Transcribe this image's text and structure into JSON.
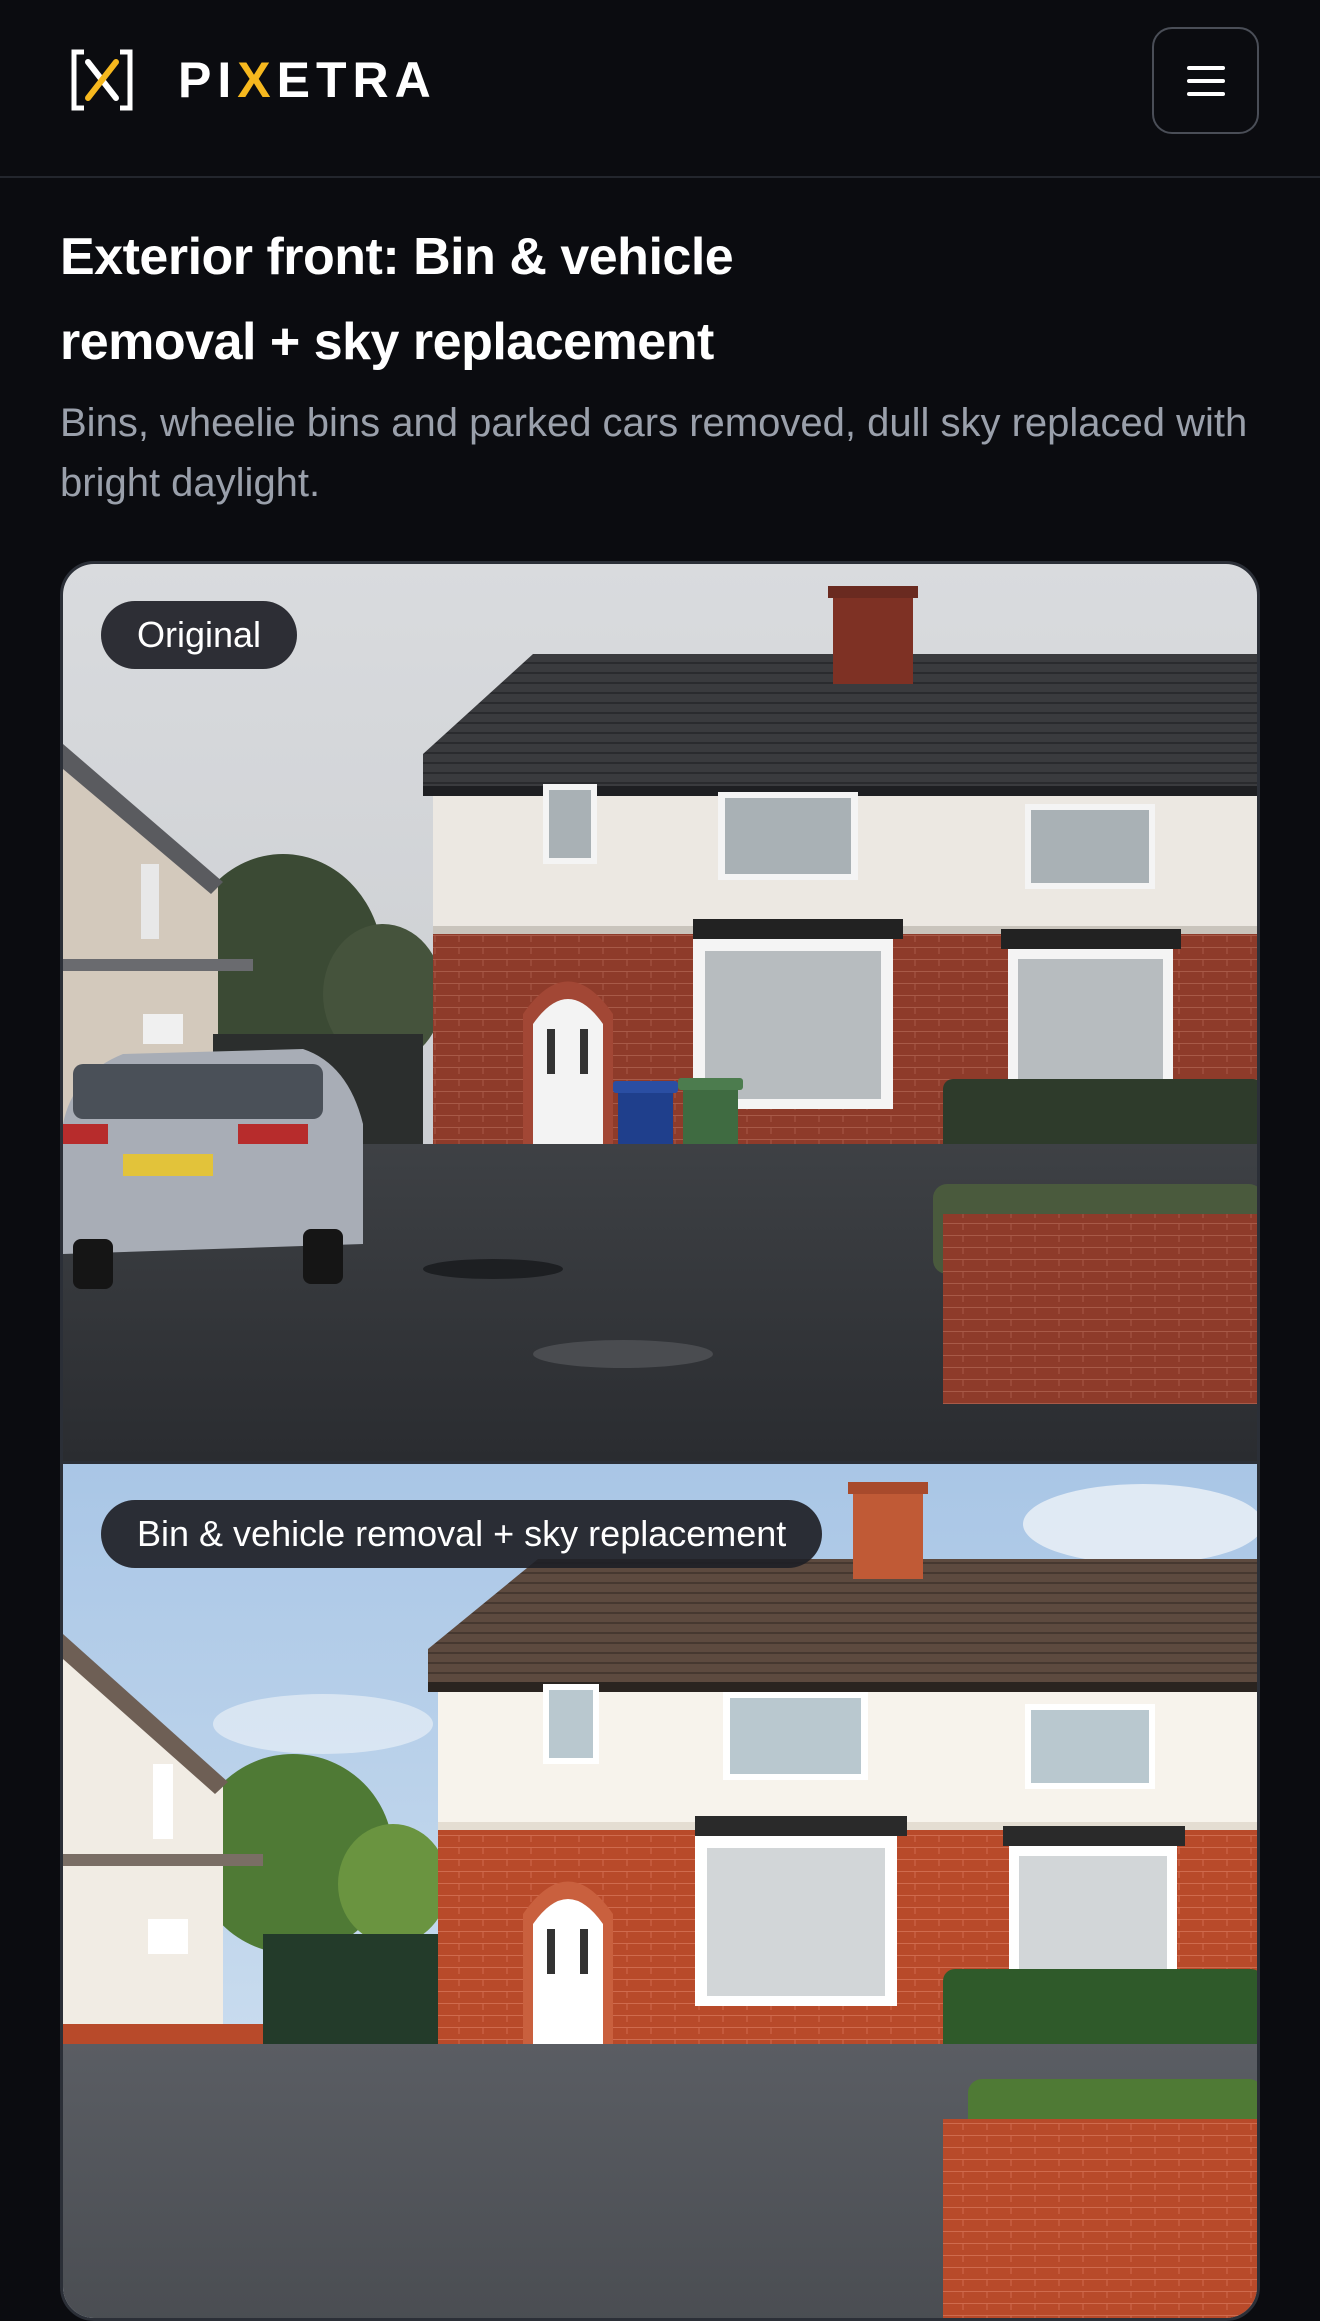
{
  "brand": {
    "name_part1": "PI",
    "name_accent": "X",
    "name_part2": "ETRA",
    "accent_color": "#f6b81e",
    "logo_icon": "bracket-x-logo-icon"
  },
  "header": {
    "menu_icon": "hamburger-menu-icon"
  },
  "page": {
    "title": "Exterior front: Bin & vehicle removal + sky replacement",
    "subtitle": "Bins, wheelie bins and parked cars removed, dull sky replaced with bright daylight."
  },
  "comparison": {
    "original_label": "Original",
    "edited_label": "Bin & vehicle removal + sky replacement"
  },
  "colors": {
    "background": "#0b0c10",
    "subtitle": "#9aa0ab",
    "badge_bg": "#1e2026"
  }
}
